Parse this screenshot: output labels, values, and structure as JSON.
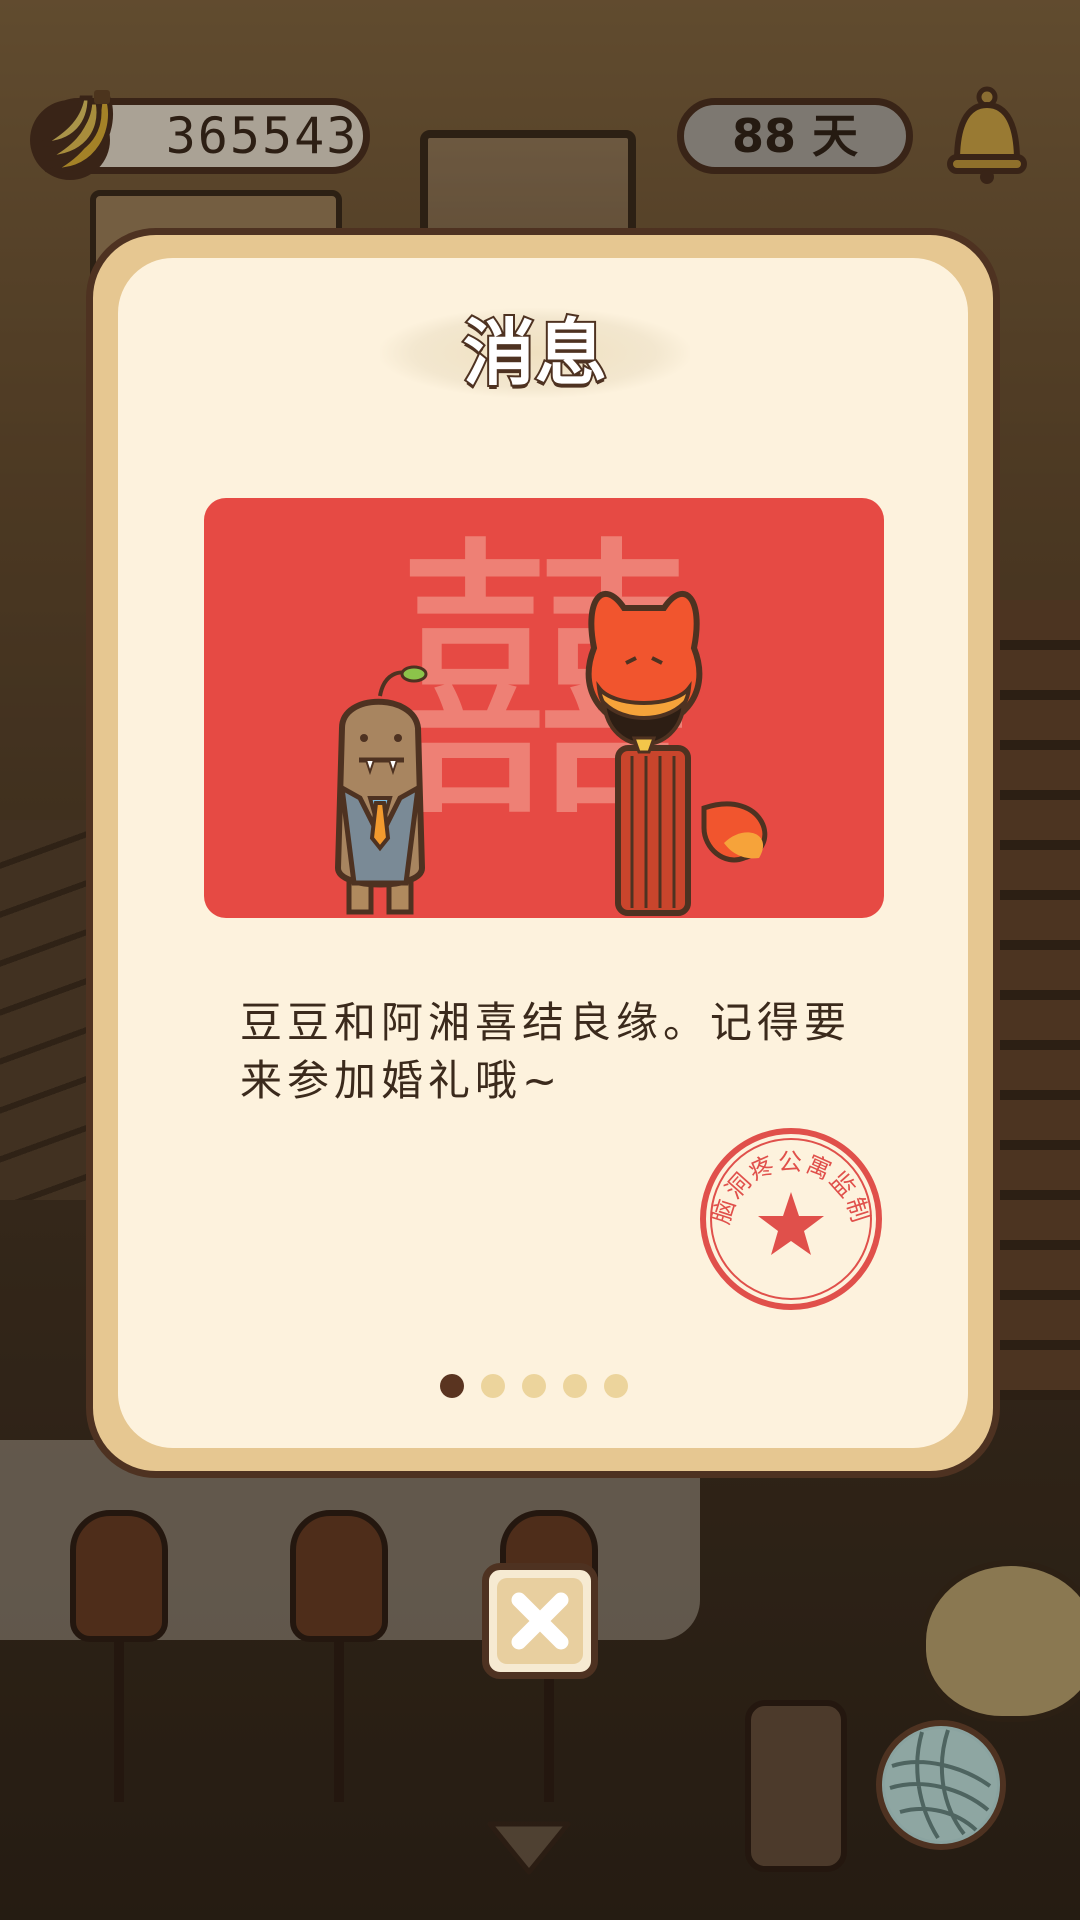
{
  "hud": {
    "bananas": "365543",
    "days": "88 天",
    "icons": {
      "currency": "banana-icon",
      "notifications": "bell-icon"
    }
  },
  "modal": {
    "title": "消息",
    "image_glyph": "囍",
    "message": "豆豆和阿湘喜结良缘。记得要来参加婚礼哦~",
    "stamp": "脑洞疼公寓监制",
    "pager": {
      "total": 5,
      "current": 1
    },
    "close_icon": "close-icon"
  },
  "scene": {
    "icons": {
      "menu_toggle": "chevron-down-icon",
      "yarn": "yarn-ball-icon"
    }
  },
  "colors": {
    "outline": "#4e3221",
    "card": "#fdf2dd",
    "frame": "#e6c791",
    "wedding_red": "#e64a44",
    "stamp_red": "#e0504b"
  }
}
